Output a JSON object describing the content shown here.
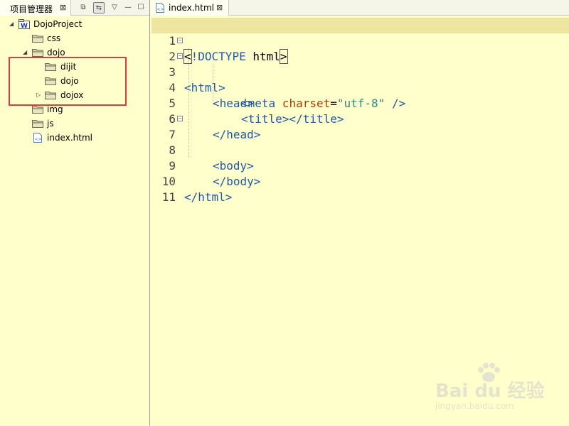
{
  "explorer": {
    "tab_title": "项目管理器",
    "close_symbol": "⊠",
    "toolbar": {
      "collapse_symbol": "⧉",
      "link_symbol": "⇆",
      "menu_symbol": "▽",
      "minimize_symbol": "—",
      "maximize_symbol": "☐"
    },
    "tree": {
      "project": "DojoProject",
      "css": "css",
      "dojo": "dojo",
      "dijit": "dijit",
      "dojo_inner": "dojo",
      "dojox": "dojox",
      "img": "img",
      "js": "js",
      "index": "index.html"
    }
  },
  "editor": {
    "tab_title": "index.html",
    "close_symbol": "⊠",
    "line_numbers": [
      "1",
      "2",
      "3",
      "4",
      "5",
      "6",
      "7",
      "8",
      "9",
      "10",
      "11"
    ],
    "current_line": 1,
    "code": {
      "l1_open": "<",
      "l1_doctype": "!DOCTYPE",
      "l1_html": " html",
      "l1_close": ">",
      "l2": "<html>",
      "l3": "<head>",
      "l4_open": "<meta",
      "l4_attr": " charset",
      "l4_eq": "=",
      "l4_val": "\"utf-8\"",
      "l4_close": " />",
      "l5": "<title></title>",
      "l6": "</head>",
      "l7": "<body>",
      "l9": "</body>",
      "l10": "</html>"
    }
  },
  "watermark": {
    "main": "Bai du 经验",
    "sub": "jingyan.baidu.com"
  }
}
